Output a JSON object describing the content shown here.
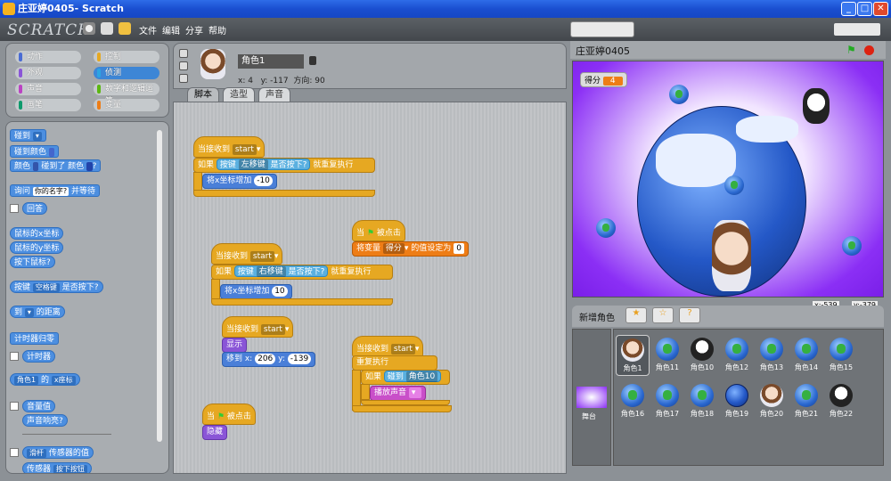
{
  "window": {
    "title": "庄亚婷0405- Scratch",
    "min": "_",
    "max": "□",
    "close": "✕"
  },
  "menu": {
    "logo": "SCRATCH",
    "items": [
      "文件",
      "编辑",
      "分享",
      "帮助"
    ]
  },
  "categories": [
    {
      "label": "动作",
      "color": "#4a6cd4"
    },
    {
      "label": "控制",
      "color": "#e6a822"
    },
    {
      "label": "外观",
      "color": "#8a55d7"
    },
    {
      "label": "侦测",
      "color": "#2ca5e2"
    },
    {
      "label": "声音",
      "color": "#bb42c3"
    },
    {
      "label": "数字和逻辑运算",
      "color": "#5cb712"
    },
    {
      "label": "画笔",
      "color": "#0e9a6c"
    },
    {
      "label": "变量",
      "color": "#ee7d16"
    }
  ],
  "palette": {
    "touching": "碰到",
    "touching_color": "碰到颜色",
    "color": "颜色",
    "color_touch": "碰到了 颜色",
    "ask": "询问",
    "ask_default": "你的名字?",
    "ask_wait": "并等待",
    "answer": "回答",
    "mouse_x": "鼠标的x坐标",
    "mouse_y": "鼠标的y坐标",
    "mouse_down": "按下鼠标?",
    "key": "按键",
    "key_space": "空格键",
    "key_pressed": "是否按下?",
    "to": "到",
    "distance": "的距离",
    "timer_reset": "计时器归零",
    "timer": "计时器",
    "sprite1": "角色1",
    "of": "的",
    "xpos": "x座标",
    "loudness": "音量值",
    "loud": "声音响亮?",
    "slider": "滑杆",
    "sensor_value": "传感器的值",
    "sensor": "传感器",
    "button_pressed": "按下按钮"
  },
  "sprite": {
    "name": "角色1",
    "x_label": "x:",
    "x": "4",
    "y_label": "y:",
    "y": "-117",
    "dir_label": "方向:",
    "dir": "90"
  },
  "tabs": [
    "脚本",
    "造型",
    "声音"
  ],
  "scripts": {
    "when_receive": "当接收到",
    "start": "start",
    "if": "如果",
    "key": "按键",
    "left": "左移键",
    "right": "右移键",
    "pressed": "是否按下?",
    "forever_if": "就重复执行",
    "change_x": "将x坐标增加",
    "neg10": "-10",
    "pos10": "10",
    "when_flag": "当",
    "clicked": "被点击",
    "set_var": "将变量",
    "score": "得分",
    "set_to": "的值设定为",
    "zero": "0",
    "show": "显示",
    "goto": "移到 x:",
    "gx": "206",
    "y": "y:",
    "gy": "-139",
    "repeat": "重复执行",
    "touching": "碰到",
    "sprite10": "角色10",
    "play_sound": "播放声音",
    "hide": "隐藏"
  },
  "stage": {
    "title": "庄亚婷0405",
    "score_label": "得分",
    "score": "4",
    "mouse_x_label": "x:",
    "mouse_x": "-539",
    "mouse_y_label": "y:",
    "mouse_y": "-379"
  },
  "sprite_list": {
    "new_sprite": "新增角色",
    "stage_label": "舞台",
    "sprites": [
      "角色1",
      "角色11",
      "角色10",
      "角色12",
      "角色13",
      "角色14",
      "角色15",
      "角色16",
      "角色17",
      "角色18",
      "角色19",
      "角色20",
      "角色21",
      "角色22"
    ]
  }
}
